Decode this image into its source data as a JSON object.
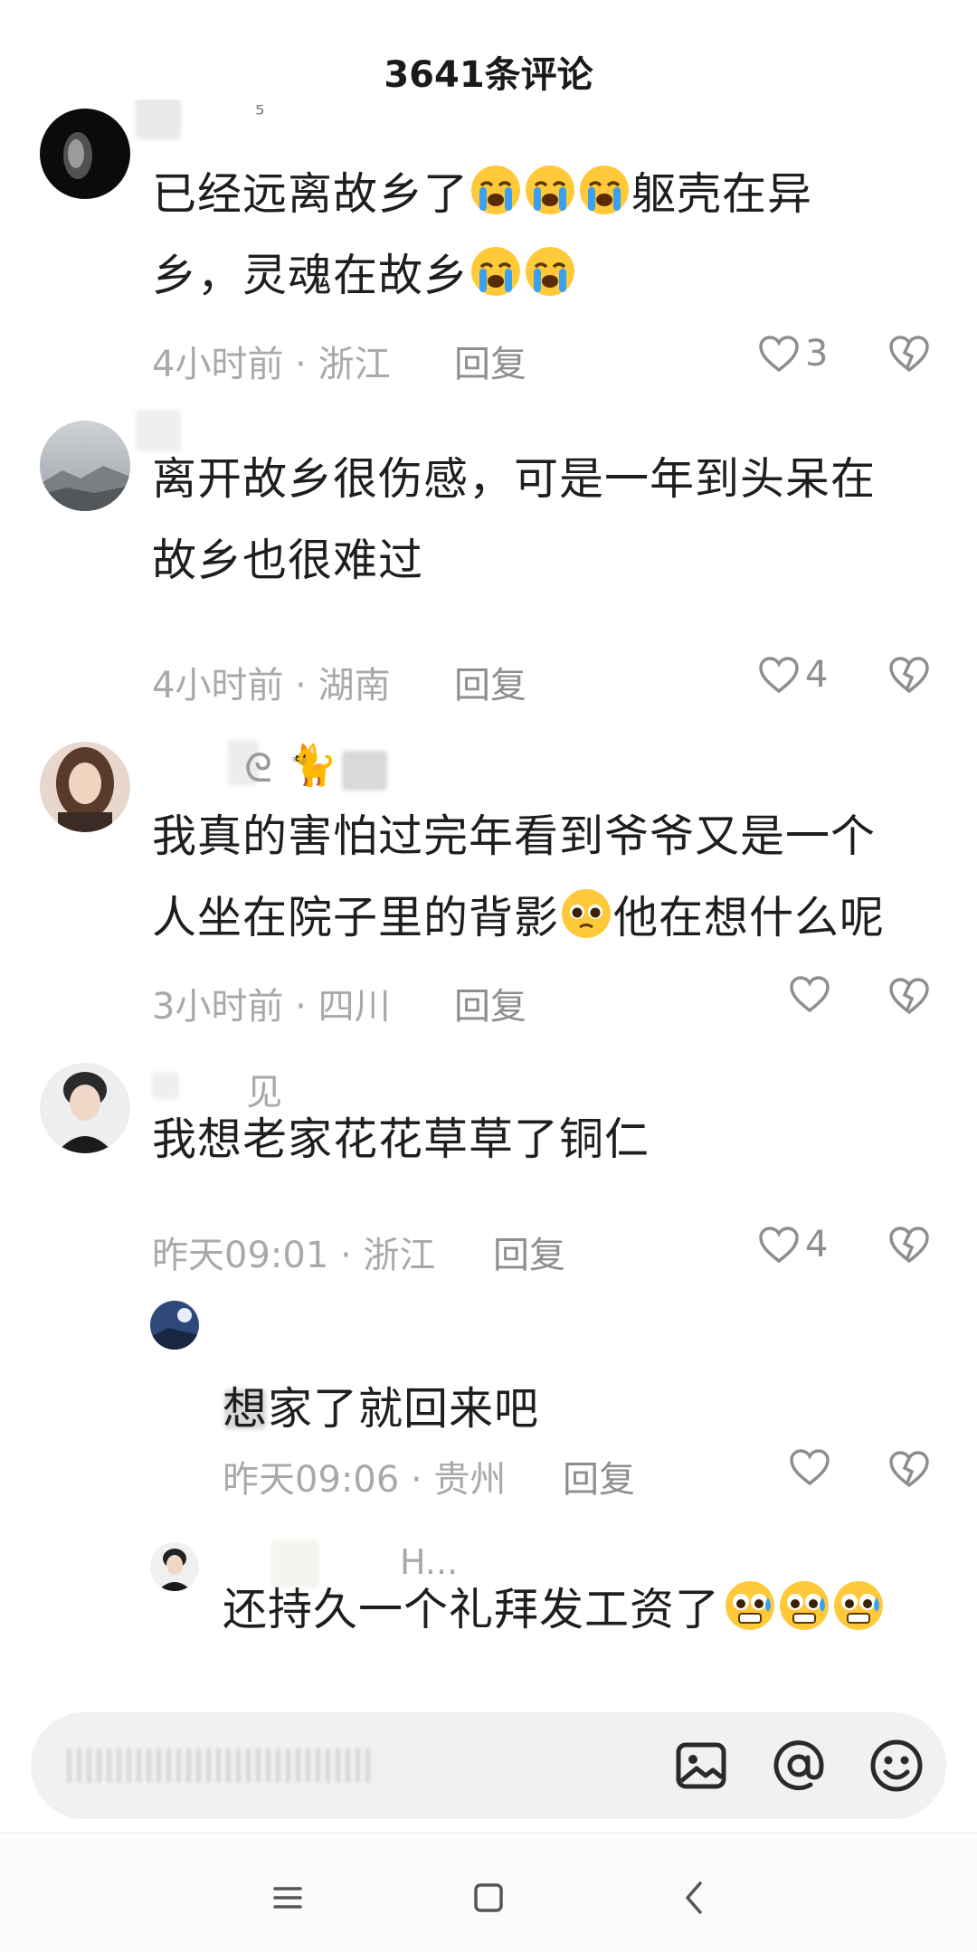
{
  "header": {
    "title": "3641条评论"
  },
  "comments": [
    {
      "username": "⁵",
      "text_line1": "已经远离故乡了",
      "text_after_cry": "躯壳在异",
      "text_line2": "乡，灵魂在故乡",
      "time_location": "4小时前 · 浙江",
      "reply_label": "回复",
      "likes": "3"
    },
    {
      "username": "",
      "text_line1": "离开故乡很伤感，可是一年到头呆在",
      "text_line2": "故乡也很难过",
      "time_location": "4小时前 · 湖南",
      "reply_label": "回复",
      "likes": "4"
    },
    {
      "username": "",
      "text_line1": "我真的害怕过完年看到爷爷又是一个",
      "text_line2_a": "人坐在院子里的背影",
      "text_line2_b": "他在想什么呢",
      "time_location": "3小时前 · 四川",
      "reply_label": "回复",
      "likes": ""
    },
    {
      "username": "见",
      "text_line1": "我想老家花花草草了铜仁",
      "time_location": "昨天09:01 · 浙江",
      "reply_label": "回复",
      "likes": "4"
    }
  ],
  "replies": [
    {
      "username": "",
      "text": "想家了就回来吧",
      "time_location": "昨天09:06 · 贵州",
      "reply_label": "回复",
      "likes": ""
    },
    {
      "username": "H...",
      "text": "还持久一个礼拜发工资了"
    }
  ],
  "icons": {
    "like": "heart-outline-icon",
    "dislike": "broken-heart-icon",
    "image": "image-icon",
    "mention": "at-icon",
    "emoji": "smiley-icon",
    "nav_menu": "menu-icon",
    "nav_home": "home-square-icon",
    "nav_back": "back-chevron-icon"
  }
}
